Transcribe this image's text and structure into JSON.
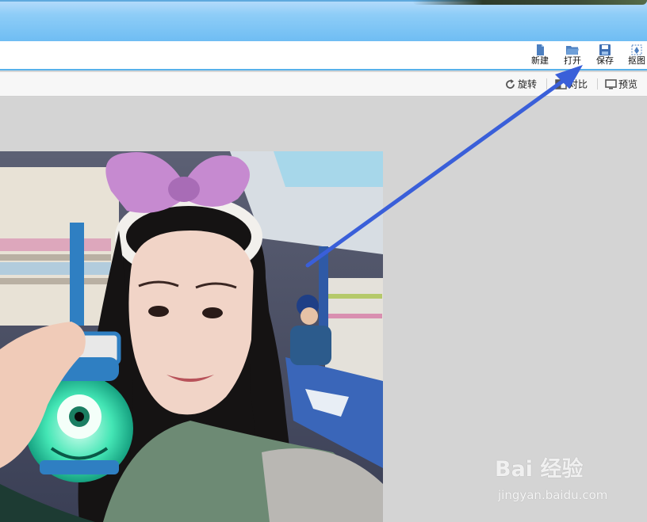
{
  "toolbar": {
    "items": [
      {
        "label": "新建",
        "icon": "new-file-icon"
      },
      {
        "label": "打开",
        "icon": "open-folder-icon"
      },
      {
        "label": "保存",
        "icon": "save-disk-icon"
      },
      {
        "label": "抠图",
        "icon": "cutout-pen-icon"
      }
    ]
  },
  "subbar": {
    "items": [
      {
        "label": "旋转",
        "icon": "rotate-icon"
      },
      {
        "label": "对比",
        "icon": "compare-icon"
      },
      {
        "label": "预览",
        "icon": "preview-icon"
      }
    ]
  },
  "watermark": {
    "logo_text": "Bai 经验",
    "url": "jingyan.baidu.com"
  },
  "colors": {
    "title_bar": "#7fc4f5",
    "accent_line": "#57b1ea",
    "arrow": "#3a5fd9",
    "canvas": "#d4d4d4"
  }
}
